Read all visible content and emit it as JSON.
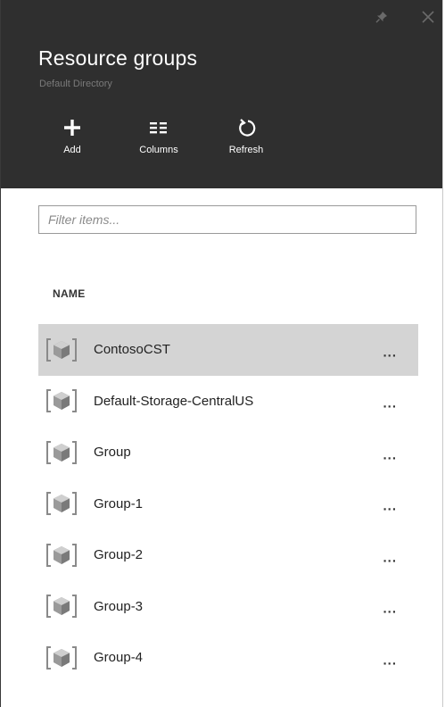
{
  "blade": {
    "title": "Resource groups",
    "subtitle": "Default Directory"
  },
  "commands": {
    "add_label": "Add",
    "columns_label": "Columns",
    "refresh_label": "Refresh"
  },
  "filter": {
    "placeholder": "Filter items...",
    "value": ""
  },
  "table": {
    "column_name": "NAME",
    "more_label": "...",
    "rows": [
      {
        "name": "ContosoCST",
        "selected": true
      },
      {
        "name": "Default-Storage-CentralUS",
        "selected": false
      },
      {
        "name": "Group",
        "selected": false
      },
      {
        "name": "Group-1",
        "selected": false
      },
      {
        "name": "Group-2",
        "selected": false
      },
      {
        "name": "Group-3",
        "selected": false
      },
      {
        "name": "Group-4",
        "selected": false
      }
    ]
  },
  "icons": {
    "pin": "pin-icon",
    "close": "close-icon",
    "add": "plus-icon",
    "columns": "columns-icon",
    "refresh": "refresh-icon",
    "row": "resource-group-icon",
    "more": "ellipsis-icon"
  },
  "colors": {
    "header_bg": "#2f2f2f",
    "selected_row": "#d4d4d4",
    "subtitle": "#7a7a7a"
  }
}
